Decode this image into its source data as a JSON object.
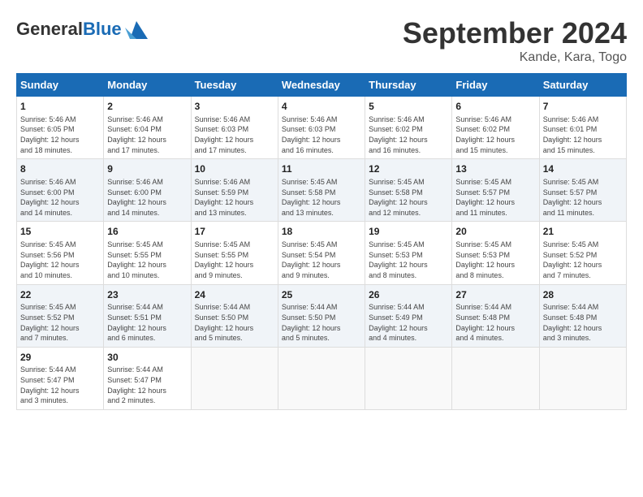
{
  "header": {
    "logo_text_general": "General",
    "logo_text_blue": "Blue",
    "month_title": "September 2024",
    "subtitle": "Kande, Kara, Togo"
  },
  "calendar": {
    "columns": [
      "Sunday",
      "Monday",
      "Tuesday",
      "Wednesday",
      "Thursday",
      "Friday",
      "Saturday"
    ],
    "weeks": [
      [
        {
          "day": "1",
          "info": "Sunrise: 5:46 AM\nSunset: 6:05 PM\nDaylight: 12 hours\nand 18 minutes."
        },
        {
          "day": "2",
          "info": "Sunrise: 5:46 AM\nSunset: 6:04 PM\nDaylight: 12 hours\nand 17 minutes."
        },
        {
          "day": "3",
          "info": "Sunrise: 5:46 AM\nSunset: 6:03 PM\nDaylight: 12 hours\nand 17 minutes."
        },
        {
          "day": "4",
          "info": "Sunrise: 5:46 AM\nSunset: 6:03 PM\nDaylight: 12 hours\nand 16 minutes."
        },
        {
          "day": "5",
          "info": "Sunrise: 5:46 AM\nSunset: 6:02 PM\nDaylight: 12 hours\nand 16 minutes."
        },
        {
          "day": "6",
          "info": "Sunrise: 5:46 AM\nSunset: 6:02 PM\nDaylight: 12 hours\nand 15 minutes."
        },
        {
          "day": "7",
          "info": "Sunrise: 5:46 AM\nSunset: 6:01 PM\nDaylight: 12 hours\nand 15 minutes."
        }
      ],
      [
        {
          "day": "8",
          "info": "Sunrise: 5:46 AM\nSunset: 6:00 PM\nDaylight: 12 hours\nand 14 minutes."
        },
        {
          "day": "9",
          "info": "Sunrise: 5:46 AM\nSunset: 6:00 PM\nDaylight: 12 hours\nand 14 minutes."
        },
        {
          "day": "10",
          "info": "Sunrise: 5:46 AM\nSunset: 5:59 PM\nDaylight: 12 hours\nand 13 minutes."
        },
        {
          "day": "11",
          "info": "Sunrise: 5:45 AM\nSunset: 5:58 PM\nDaylight: 12 hours\nand 13 minutes."
        },
        {
          "day": "12",
          "info": "Sunrise: 5:45 AM\nSunset: 5:58 PM\nDaylight: 12 hours\nand 12 minutes."
        },
        {
          "day": "13",
          "info": "Sunrise: 5:45 AM\nSunset: 5:57 PM\nDaylight: 12 hours\nand 11 minutes."
        },
        {
          "day": "14",
          "info": "Sunrise: 5:45 AM\nSunset: 5:57 PM\nDaylight: 12 hours\nand 11 minutes."
        }
      ],
      [
        {
          "day": "15",
          "info": "Sunrise: 5:45 AM\nSunset: 5:56 PM\nDaylight: 12 hours\nand 10 minutes."
        },
        {
          "day": "16",
          "info": "Sunrise: 5:45 AM\nSunset: 5:55 PM\nDaylight: 12 hours\nand 10 minutes."
        },
        {
          "day": "17",
          "info": "Sunrise: 5:45 AM\nSunset: 5:55 PM\nDaylight: 12 hours\nand 9 minutes."
        },
        {
          "day": "18",
          "info": "Sunrise: 5:45 AM\nSunset: 5:54 PM\nDaylight: 12 hours\nand 9 minutes."
        },
        {
          "day": "19",
          "info": "Sunrise: 5:45 AM\nSunset: 5:53 PM\nDaylight: 12 hours\nand 8 minutes."
        },
        {
          "day": "20",
          "info": "Sunrise: 5:45 AM\nSunset: 5:53 PM\nDaylight: 12 hours\nand 8 minutes."
        },
        {
          "day": "21",
          "info": "Sunrise: 5:45 AM\nSunset: 5:52 PM\nDaylight: 12 hours\nand 7 minutes."
        }
      ],
      [
        {
          "day": "22",
          "info": "Sunrise: 5:45 AM\nSunset: 5:52 PM\nDaylight: 12 hours\nand 7 minutes."
        },
        {
          "day": "23",
          "info": "Sunrise: 5:44 AM\nSunset: 5:51 PM\nDaylight: 12 hours\nand 6 minutes."
        },
        {
          "day": "24",
          "info": "Sunrise: 5:44 AM\nSunset: 5:50 PM\nDaylight: 12 hours\nand 5 minutes."
        },
        {
          "day": "25",
          "info": "Sunrise: 5:44 AM\nSunset: 5:50 PM\nDaylight: 12 hours\nand 5 minutes."
        },
        {
          "day": "26",
          "info": "Sunrise: 5:44 AM\nSunset: 5:49 PM\nDaylight: 12 hours\nand 4 minutes."
        },
        {
          "day": "27",
          "info": "Sunrise: 5:44 AM\nSunset: 5:48 PM\nDaylight: 12 hours\nand 4 minutes."
        },
        {
          "day": "28",
          "info": "Sunrise: 5:44 AM\nSunset: 5:48 PM\nDaylight: 12 hours\nand 3 minutes."
        }
      ],
      [
        {
          "day": "29",
          "info": "Sunrise: 5:44 AM\nSunset: 5:47 PM\nDaylight: 12 hours\nand 3 minutes."
        },
        {
          "day": "30",
          "info": "Sunrise: 5:44 AM\nSunset: 5:47 PM\nDaylight: 12 hours\nand 2 minutes."
        },
        null,
        null,
        null,
        null,
        null
      ]
    ]
  }
}
